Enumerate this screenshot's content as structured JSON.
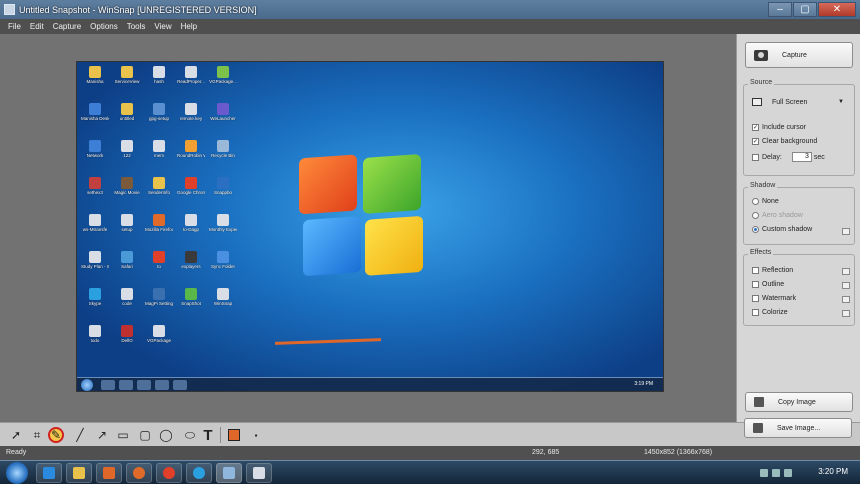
{
  "window": {
    "title": "Untitled Snapshot - WinSnap  [UNREGISTERED VERSION]",
    "minimize": "–",
    "maximize": "▢",
    "close": "✕"
  },
  "menu": [
    "File",
    "Edit",
    "Capture",
    "Options",
    "Tools",
    "View",
    "Help"
  ],
  "desktop": {
    "icons": [
      {
        "label": "Manisha",
        "color": "#e8c24a"
      },
      {
        "label": "ServiceView",
        "color": "#e8c24a"
      },
      {
        "label": "hash",
        "color": "#d8dde6"
      },
      {
        "label": "ReadProper...",
        "color": "#d8dde6"
      },
      {
        "label": "VGPackage...",
        "color": "#7cc24a"
      },
      {
        "label": "Manisha Desktop",
        "color": "#3d7fd6"
      },
      {
        "label": "untitled",
        "color": "#e8c24a"
      },
      {
        "label": "gpg-setup",
        "color": "#5a8fd0"
      },
      {
        "label": "remote.key",
        "color": "#d8dde6"
      },
      {
        "label": "WeLauncher",
        "color": "#6a5acd"
      },
      {
        "label": "Network",
        "color": "#3d7fd6"
      },
      {
        "label": "122",
        "color": "#d8dde6"
      },
      {
        "label": "mem",
        "color": "#d8dde6"
      },
      {
        "label": "RoundRobin Windows...",
        "color": "#f0a030"
      },
      {
        "label": "Recycle Bin",
        "color": "#9ab8d8"
      },
      {
        "label": "sethex3",
        "color": "#c04040"
      },
      {
        "label": "Magic Movie",
        "color": "#7a5a3a"
      },
      {
        "label": "SenderInfo",
        "color": "#e8c24a"
      },
      {
        "label": "Google Chrome",
        "color": "#e0402a"
      },
      {
        "label": "Snappbo",
        "color": "#2a6fc1"
      },
      {
        "label": "ws-Mtransfe",
        "color": "#d8dde6"
      },
      {
        "label": "setup",
        "color": "#d8dde6"
      },
      {
        "label": "Mozilla Firefox",
        "color": "#e06a2a"
      },
      {
        "label": "to-Dagp",
        "color": "#d8dde6"
      },
      {
        "label": "Monthly Expense...",
        "color": "#d8dde6"
      },
      {
        "label": "Study Plan - Shared",
        "color": "#d8dde6"
      },
      {
        "label": "Safari",
        "color": "#4a9ad8"
      },
      {
        "label": "to",
        "color": "#e0402a"
      },
      {
        "label": "explayers",
        "color": "#3a3a3a"
      },
      {
        "label": "Sync Folder",
        "color": "#4a90e0"
      },
      {
        "label": "Skype",
        "color": "#2aa0e0"
      },
      {
        "label": "code",
        "color": "#d8dde6"
      },
      {
        "label": "MagPi Settings",
        "color": "#3a6fb0"
      },
      {
        "label": "SnapShot",
        "color": "#5ab84a"
      },
      {
        "label": "WinSnap",
        "color": "#d8dde6"
      },
      {
        "label": "todo",
        "color": "#d8dde6"
      },
      {
        "label": "DellO",
        "color": "#c03030"
      },
      {
        "label": "VGPackage",
        "color": "#d8dde6"
      }
    ],
    "clock": "3:19 PM"
  },
  "panel": {
    "capture_label": "Capture",
    "source": {
      "legend": "Source",
      "mode": "Full Screen",
      "include_cursor": "Include cursor",
      "clear_background": "Clear background",
      "delay_label": "Delay:",
      "delay_value": "3",
      "delay_unit": "sec"
    },
    "shadow": {
      "legend": "Shadow",
      "none": "None",
      "aero": "Aero shadow",
      "custom": "Custom shadow"
    },
    "effects": {
      "legend": "Effects",
      "reflection": "Reflection",
      "outline": "Outline",
      "watermark": "Watermark",
      "colorize": "Colorize"
    },
    "copy_label": "Copy Image",
    "save_label": "Save Image..."
  },
  "toolbar": {
    "tools": [
      "select-icon",
      "crop-icon",
      "highlighter-icon",
      "line-icon",
      "arrow-icon",
      "rectangle-icon",
      "rounded-rectangle-icon",
      "ellipse-icon",
      "text-icon",
      "color-swatch",
      "more-icon"
    ],
    "text_tool_glyph": "T",
    "accent_color": "#e0672a"
  },
  "status": {
    "left": "Ready",
    "coords": "292, 685",
    "size": "1450x852 (1366x768)"
  },
  "taskbar": {
    "clock": "3:20 PM"
  }
}
